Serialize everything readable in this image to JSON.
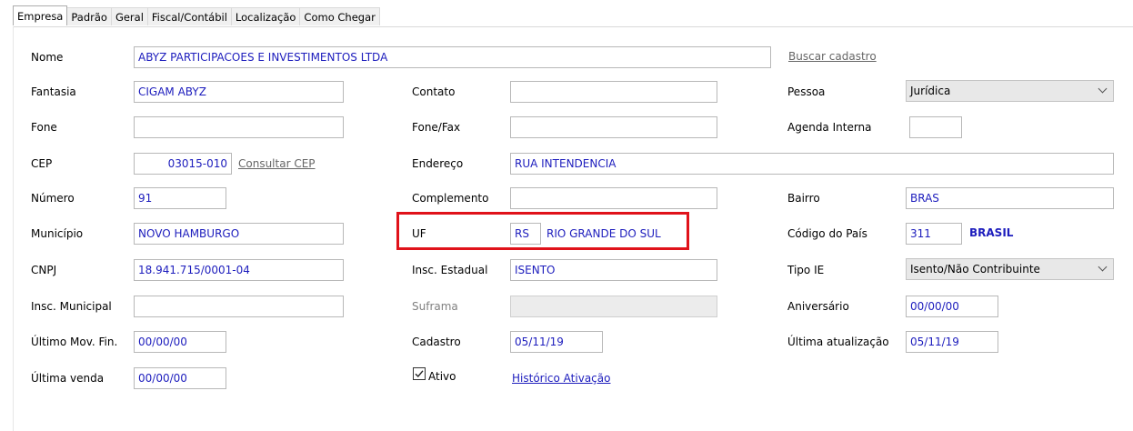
{
  "tabs": [
    "Empresa",
    "Padrão",
    "Geral",
    "Fiscal/Contábil",
    "Localização",
    "Como Chegar"
  ],
  "labels": {
    "nome": "Nome",
    "fantasia": "Fantasia",
    "fone": "Fone",
    "cep": "CEP",
    "numero": "Número",
    "municipio": "Município",
    "cnpj": "CNPJ",
    "insc_municipal": "Insc. Municipal",
    "ultimo_mov_fin": "Último Mov. Fin.",
    "ultima_venda": "Última venda",
    "contato": "Contato",
    "fone_fax": "Fone/Fax",
    "endereco": "Endereço",
    "complemento": "Complemento",
    "uf": "UF",
    "insc_estadual": "Insc. Estadual",
    "suframa": "Suframa",
    "cadastro": "Cadastro",
    "ativo": "Ativo",
    "pessoa": "Pessoa",
    "agenda_interna": "Agenda Interna",
    "bairro": "Bairro",
    "codigo_pais": "Código do País",
    "tipo_ie": "Tipo IE",
    "aniversario": "Aniversário",
    "ultima_atualizacao": "Última atualização"
  },
  "links": {
    "buscar_cadastro": "Buscar cadastro",
    "consultar_cep": "Consultar CEP",
    "historico_ativacao": "Histórico Ativação"
  },
  "values": {
    "nome": "ABYZ PARTICIPACOES E INVESTIMENTOS LTDA",
    "fantasia": "CIGAM ABYZ",
    "fone": "",
    "cep": "03015-010",
    "numero": "91",
    "municipio": "NOVO HAMBURGO",
    "cnpj": "18.941.715/0001-04",
    "insc_municipal": "",
    "ultimo_mov_fin": "00/00/00",
    "ultima_venda": "00/00/00",
    "contato": "",
    "fone_fax": "",
    "endereco": "RUA INTENDENCIA",
    "complemento": "",
    "uf": "RS",
    "uf_nome": "RIO GRANDE DO SUL",
    "insc_estadual": "ISENTO",
    "suframa": "",
    "cadastro": "05/11/19",
    "ativo_checked": true,
    "pessoa": "Jurídica",
    "agenda_interna": "",
    "bairro": "BRAS",
    "codigo_pais": "311",
    "pais_nome": "BRASIL",
    "tipo_ie": "Isento/Não Contribuinte",
    "aniversario": "00/00/00",
    "ultima_atualizacao": "05/11/19"
  },
  "colors": {
    "value_text": "#1d1dbd",
    "highlight_border": "#e0121a"
  }
}
